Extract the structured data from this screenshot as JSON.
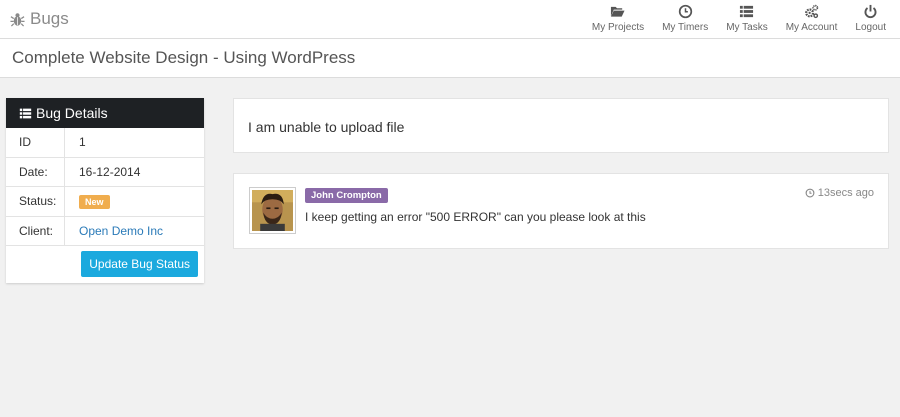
{
  "app": {
    "brand": "Bugs",
    "brand_icon": "bug-icon"
  },
  "nav": [
    {
      "label": "My Projects",
      "icon": "folder-open-icon"
    },
    {
      "label": "My Timers",
      "icon": "clock-icon"
    },
    {
      "label": "My Tasks",
      "icon": "list-icon"
    },
    {
      "label": "My Account",
      "icon": "gears-icon"
    },
    {
      "label": "Logout",
      "icon": "power-icon"
    }
  ],
  "page": {
    "title": "Complete Website Design - Using WordPress"
  },
  "bug_details": {
    "heading": "Bug Details",
    "heading_icon": "list-icon",
    "rows": [
      {
        "key": "ID",
        "value": "1"
      },
      {
        "key": "Date:",
        "value": "16-12-2014"
      },
      {
        "key": "Status:",
        "value": "New"
      },
      {
        "key": "Client:",
        "value": "Open Demo Inc"
      }
    ],
    "button_label": "Update Bug Status"
  },
  "issue": {
    "text": "I am unable to upload file"
  },
  "comment": {
    "author": "John Crompton",
    "message": "I keep getting an error \"500 ERROR\" can you please look at this",
    "time": "13secs ago"
  },
  "colors": {
    "dark_header": "#1e2124",
    "status_new": "#f0ad4e",
    "author_badge": "#8a6aa8",
    "button": "#1ba9de",
    "link": "#2a7ab8"
  }
}
